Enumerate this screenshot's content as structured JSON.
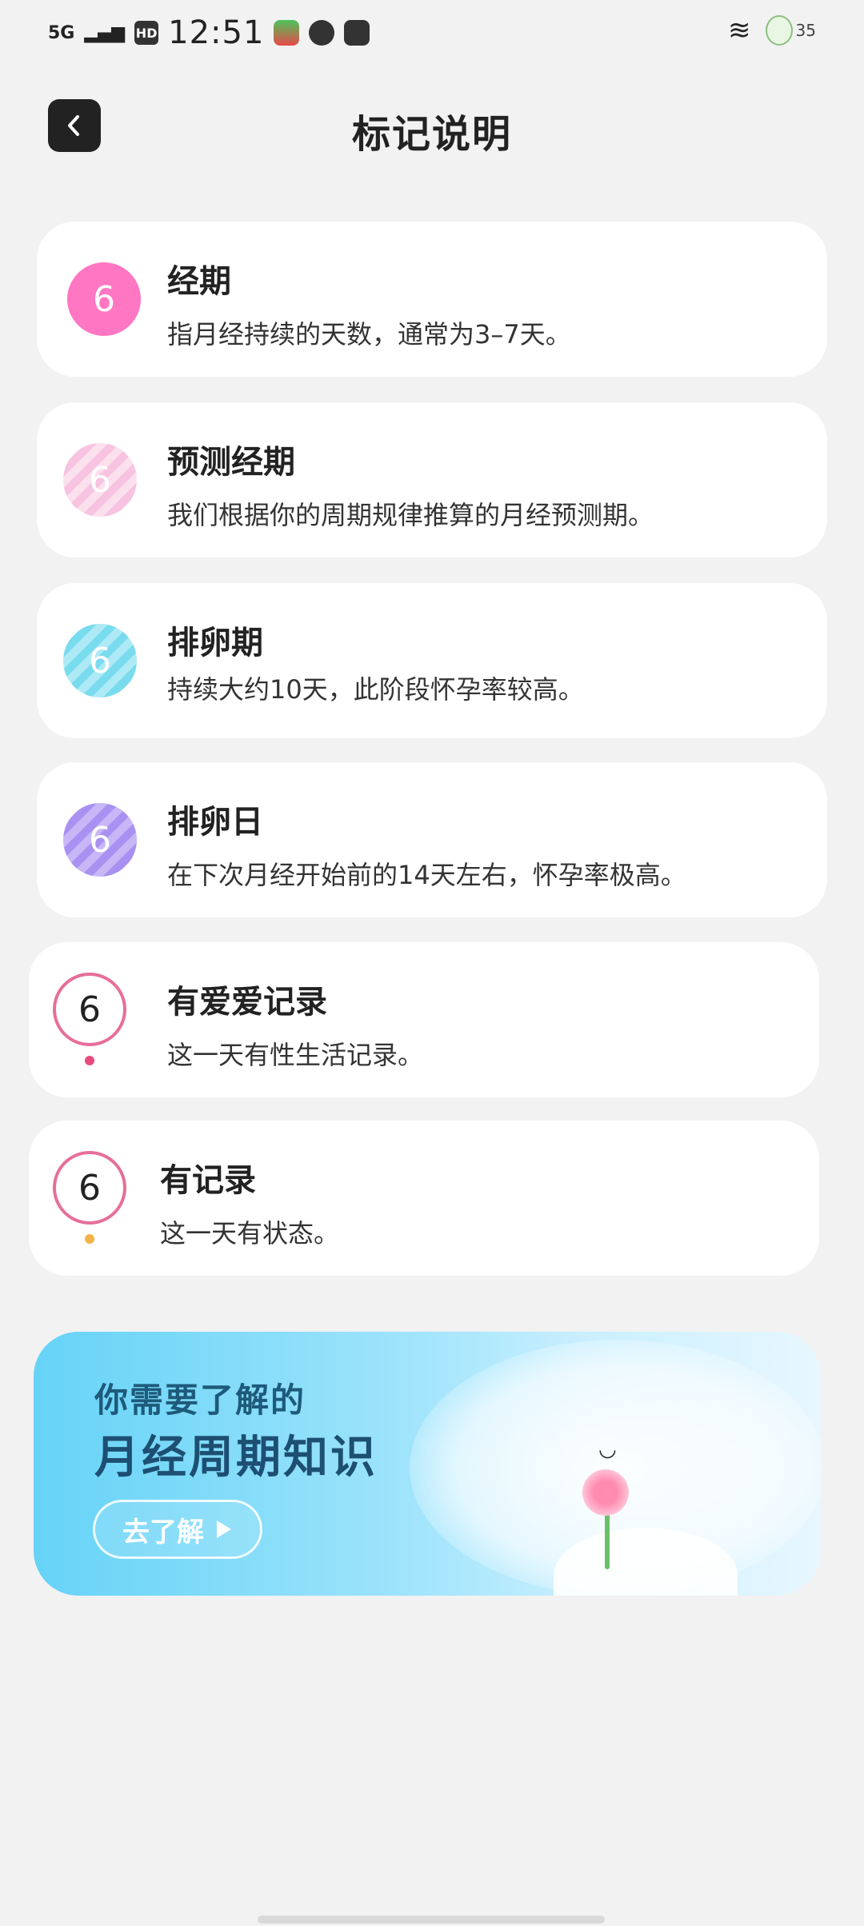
{
  "status": {
    "network": "5G",
    "hd": "HD",
    "time": "12:51",
    "battery": "35"
  },
  "header": {
    "title": "标记说明"
  },
  "legend": [
    {
      "day": "6",
      "label": "经期",
      "desc": "指月经持续的天数，通常为3–7天。"
    },
    {
      "day": "6",
      "label": "预测经期",
      "desc": "我们根据你的周期规律推算的月经预测期。"
    },
    {
      "day": "6",
      "label": "排卵期",
      "desc": "持续大约10天，此阶段怀孕率较高。"
    },
    {
      "day": "6",
      "label": "排卵日",
      "desc": "在下次月经开始前的14天左右，怀孕率极高。"
    },
    {
      "day": "6",
      "label": "有爱爱记录",
      "desc": "这一天有性生活记录。"
    },
    {
      "day": "6",
      "label": "有记录",
      "desc": "这一天有状态。"
    }
  ],
  "banner": {
    "line1": "你需要了解的",
    "line2": "月经周期知识",
    "cta": "去了解"
  },
  "colors": {
    "period": "#ff77c3",
    "predicted": "#f7c3e0",
    "ovulation": "#79dbee",
    "ovulation_day": "#a991f2",
    "ring": "#e76e9a",
    "love_dot": "#e94b7d",
    "record_dot": "#f6b24a"
  }
}
